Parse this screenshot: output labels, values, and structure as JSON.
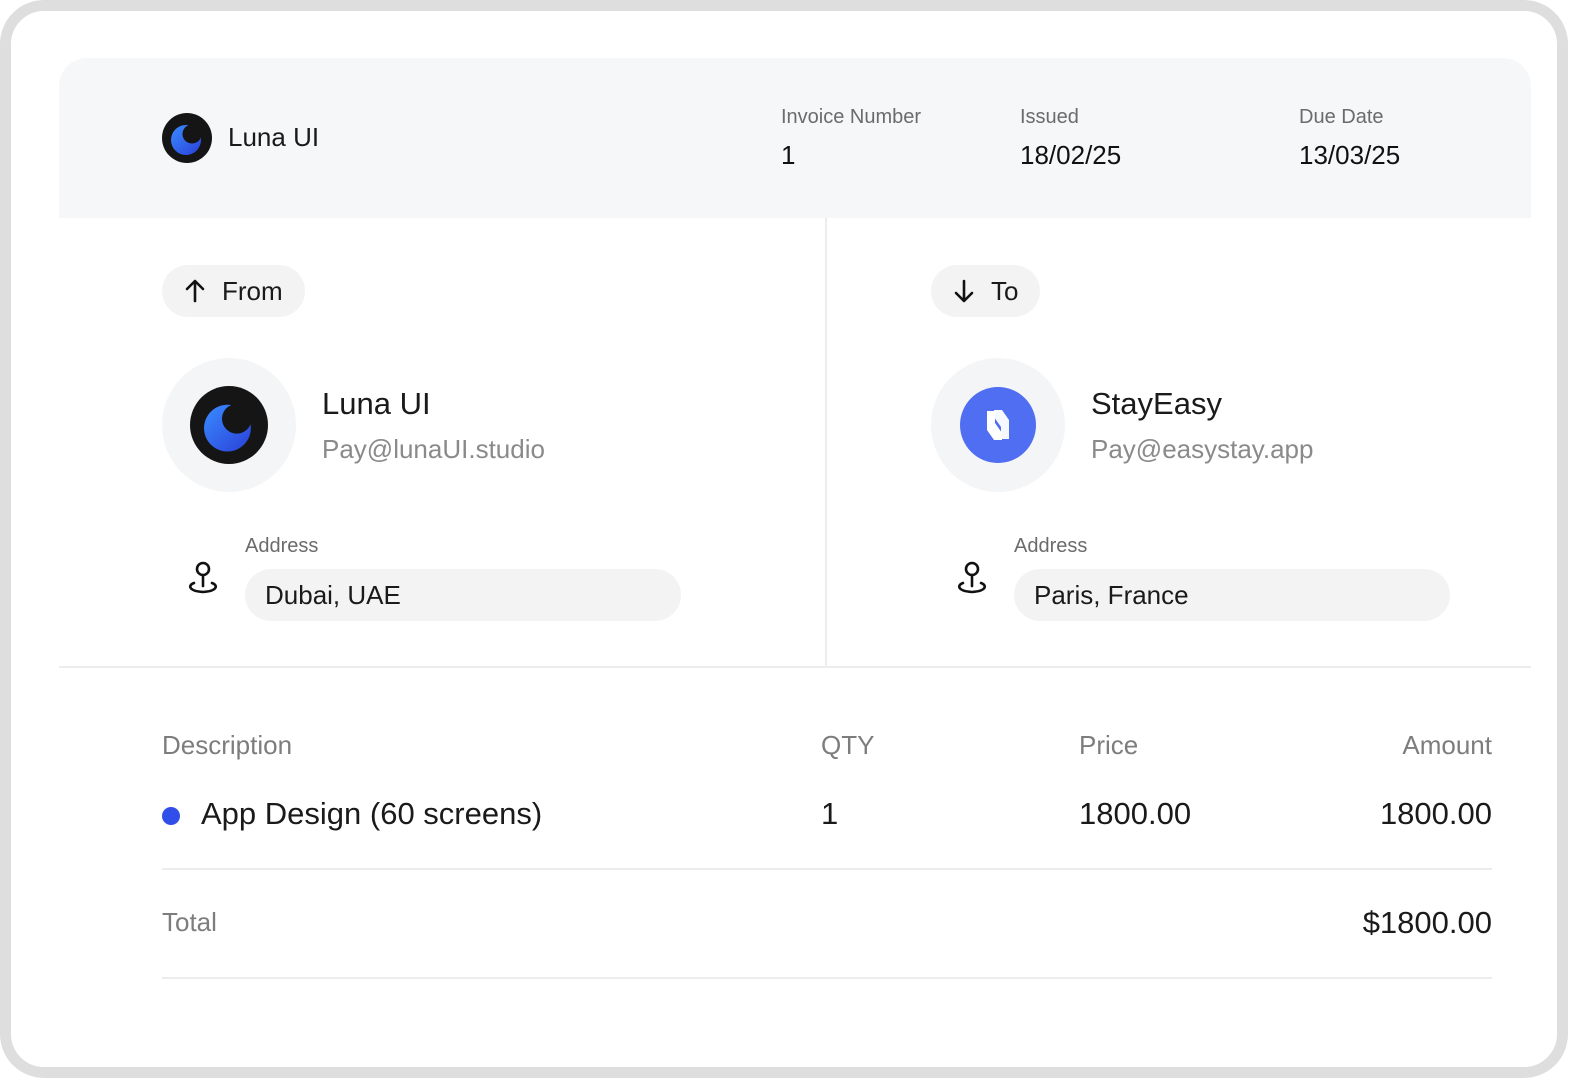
{
  "header": {
    "brand": "Luna UI",
    "logo_icon": "luna-moon-icon",
    "invoice_number_label": "Invoice Number",
    "invoice_number": "1",
    "issued_label": "Issued",
    "issued": "18/02/25",
    "due_label": "Due Date",
    "due": "13/03/25"
  },
  "from": {
    "pill_label": "From",
    "pill_icon": "arrow-up-icon",
    "name": "Luna UI",
    "email": "Pay@lunaUI.studio",
    "avatar_icon": "luna-moon-icon",
    "address_label": "Address",
    "address": "Dubai, UAE",
    "address_icon": "location-pin-icon"
  },
  "to": {
    "pill_label": "To",
    "pill_icon": "arrow-down-icon",
    "name": "StayEasy",
    "email": "Pay@easystay.app",
    "avatar_icon": "stayeasy-logo-icon",
    "address_label": "Address",
    "address": "Paris, France",
    "address_icon": "location-pin-icon"
  },
  "table": {
    "headers": {
      "description": "Description",
      "qty": "QTY",
      "price": "Price",
      "amount": "Amount"
    },
    "rows": [
      {
        "description": "App Design (60 screens)",
        "qty": "1",
        "price": "1800.00",
        "amount": "1800.00",
        "dot_color": "#2f4fe8"
      }
    ],
    "total_label": "Total",
    "total": "$1800.00"
  },
  "colors": {
    "accent": "#2f4fe8",
    "stayeasy_brand": "#4f6ef2",
    "header_bg": "#f6f7f9"
  }
}
